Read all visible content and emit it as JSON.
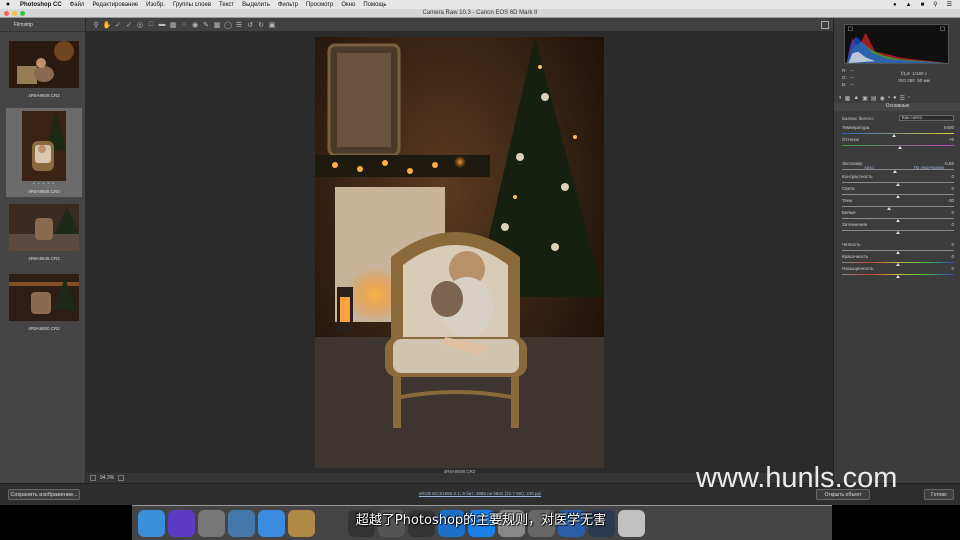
{
  "menubar": {
    "apple": "",
    "items": [
      "Photoshop CC",
      "Файл",
      "Редактирование",
      "Изобр.",
      "Группы слоев",
      "Текст",
      "Выделить",
      "Фильтр",
      "Просмотр",
      "Окно",
      "Помощь"
    ]
  },
  "window": {
    "title": "Camera Raw 10.3 - Canon EOS 6D Mark II"
  },
  "filmstrip": {
    "header": "Filmstrip",
    "thumbs": [
      {
        "name": "4R9A9609.CR2",
        "stars": ""
      },
      {
        "name": "4R9A9608.CR2",
        "stars": "• • • • •"
      },
      {
        "name": "4R9A9645.CR2",
        "stars": ""
      },
      {
        "name": "4R9A9650.CR2",
        "stars": ""
      }
    ]
  },
  "canvas": {
    "photo_name": "4R9A9608.CR2",
    "zoom": "94.3%"
  },
  "bottombar": {
    "save_label": "Сохранить изображение...",
    "workflow_link": "sRGB IEC61966-2.1; 8 бит; 3888 на 5832 (22.7 Мп); 240 ppi",
    "open_label": "Открыть объект",
    "done_label": "Готово"
  },
  "rpanel": {
    "cam_info": {
      "f": "f/1,8",
      "shutter": "1/160 c",
      "iso": "ISO 250",
      "focal": "50 мм",
      "r_label": "R:",
      "g_label": "G:",
      "b_label": "B:",
      "r": "---",
      "g": "---",
      "b": "---"
    },
    "section_title": "Основные",
    "wb_label": "Баланс белого:",
    "wb_value": "Как снято",
    "auto_label": "Авто",
    "default_label": "По умолчанию",
    "sliders": [
      {
        "label": "Температура",
        "value": "5400",
        "level": 0.46
      },
      {
        "label": "Оттенок",
        "value": "+5",
        "level": 0.52
      },
      {
        "label": "Экспонир.",
        "value": "-0,55",
        "level": 0.47
      },
      {
        "label": "Контрастность",
        "value": "0",
        "level": 0.5
      },
      {
        "label": "Света",
        "value": "0",
        "level": 0.5
      },
      {
        "label": "Тени",
        "value": "-30",
        "level": 0.42
      },
      {
        "label": "Белые",
        "value": "0",
        "level": 0.5
      },
      {
        "label": "Затемнение",
        "value": "0",
        "level": 0.5
      },
      {
        "label": "Четкость",
        "value": "0",
        "level": 0.5
      },
      {
        "label": "Красочность",
        "value": "0",
        "level": 0.5
      },
      {
        "label": "Насыщенность",
        "value": "0",
        "level": 0.5
      }
    ]
  },
  "subtitle": "超越了Photoshop的主要规则，对医学无害",
  "watermark": "www.hunls.com",
  "dock": {
    "icons": [
      "finder-icon",
      "siri-icon",
      "launchpad-icon",
      "preview-icon",
      "safari-icon",
      "notes-icon",
      "photo-app-icon",
      "app-icon-1",
      "app-icon-2",
      "app-icon-3",
      "app-icon-4",
      "appstore-icon",
      "settings-icon",
      "camera-icon",
      "chrome-icon",
      "photoshop-icon",
      "trash-icon"
    ],
    "colors": [
      "#3b8ed8",
      "#5c3cc4",
      "#777",
      "#4477aa",
      "#3a8be0",
      "#b08944",
      "#444",
      "#333",
      "#555",
      "#333",
      "#1d6fc7",
      "#1b7fe8",
      "#888",
      "#666",
      "#2a5ea8",
      "#2a3a50",
      "#c0c0c0"
    ]
  }
}
